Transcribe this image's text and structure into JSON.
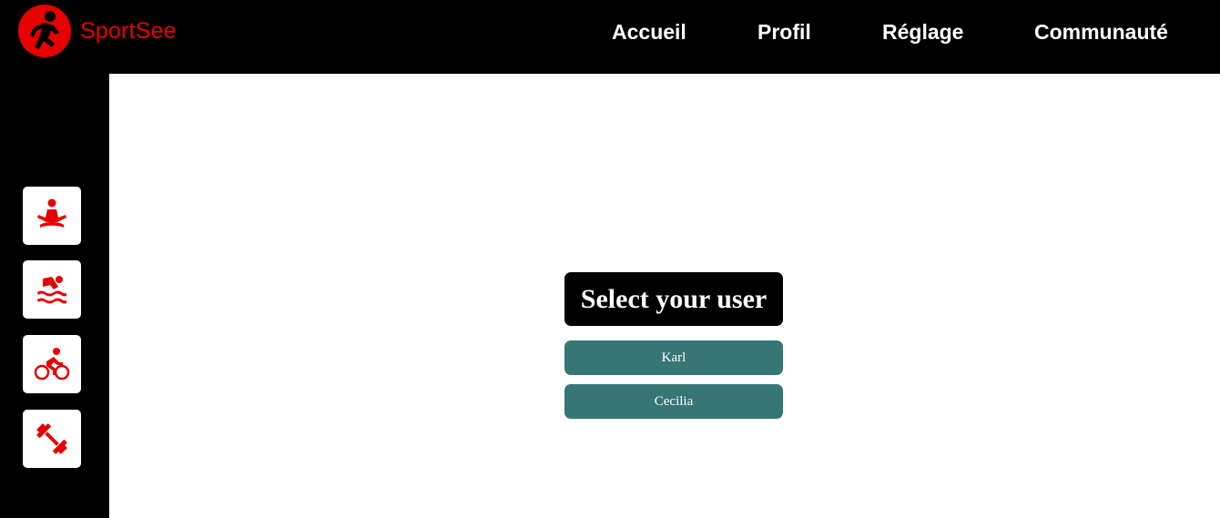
{
  "header": {
    "brand": "SportSee",
    "nav": [
      {
        "label": "Accueil"
      },
      {
        "label": "Profil"
      },
      {
        "label": "Réglage"
      },
      {
        "label": "Communauté"
      }
    ]
  },
  "sidebar": {
    "items": [
      {
        "icon": "meditation-icon"
      },
      {
        "icon": "swimming-icon"
      },
      {
        "icon": "cycling-icon"
      },
      {
        "icon": "dumbbell-icon"
      }
    ]
  },
  "main": {
    "title": "Select your user",
    "users": [
      {
        "label": "Karl"
      },
      {
        "label": "Cecilia"
      }
    ]
  },
  "colors": {
    "accent": "#e60000",
    "bar": "#000000",
    "user_button": "#367674",
    "background": "#ffffff"
  }
}
